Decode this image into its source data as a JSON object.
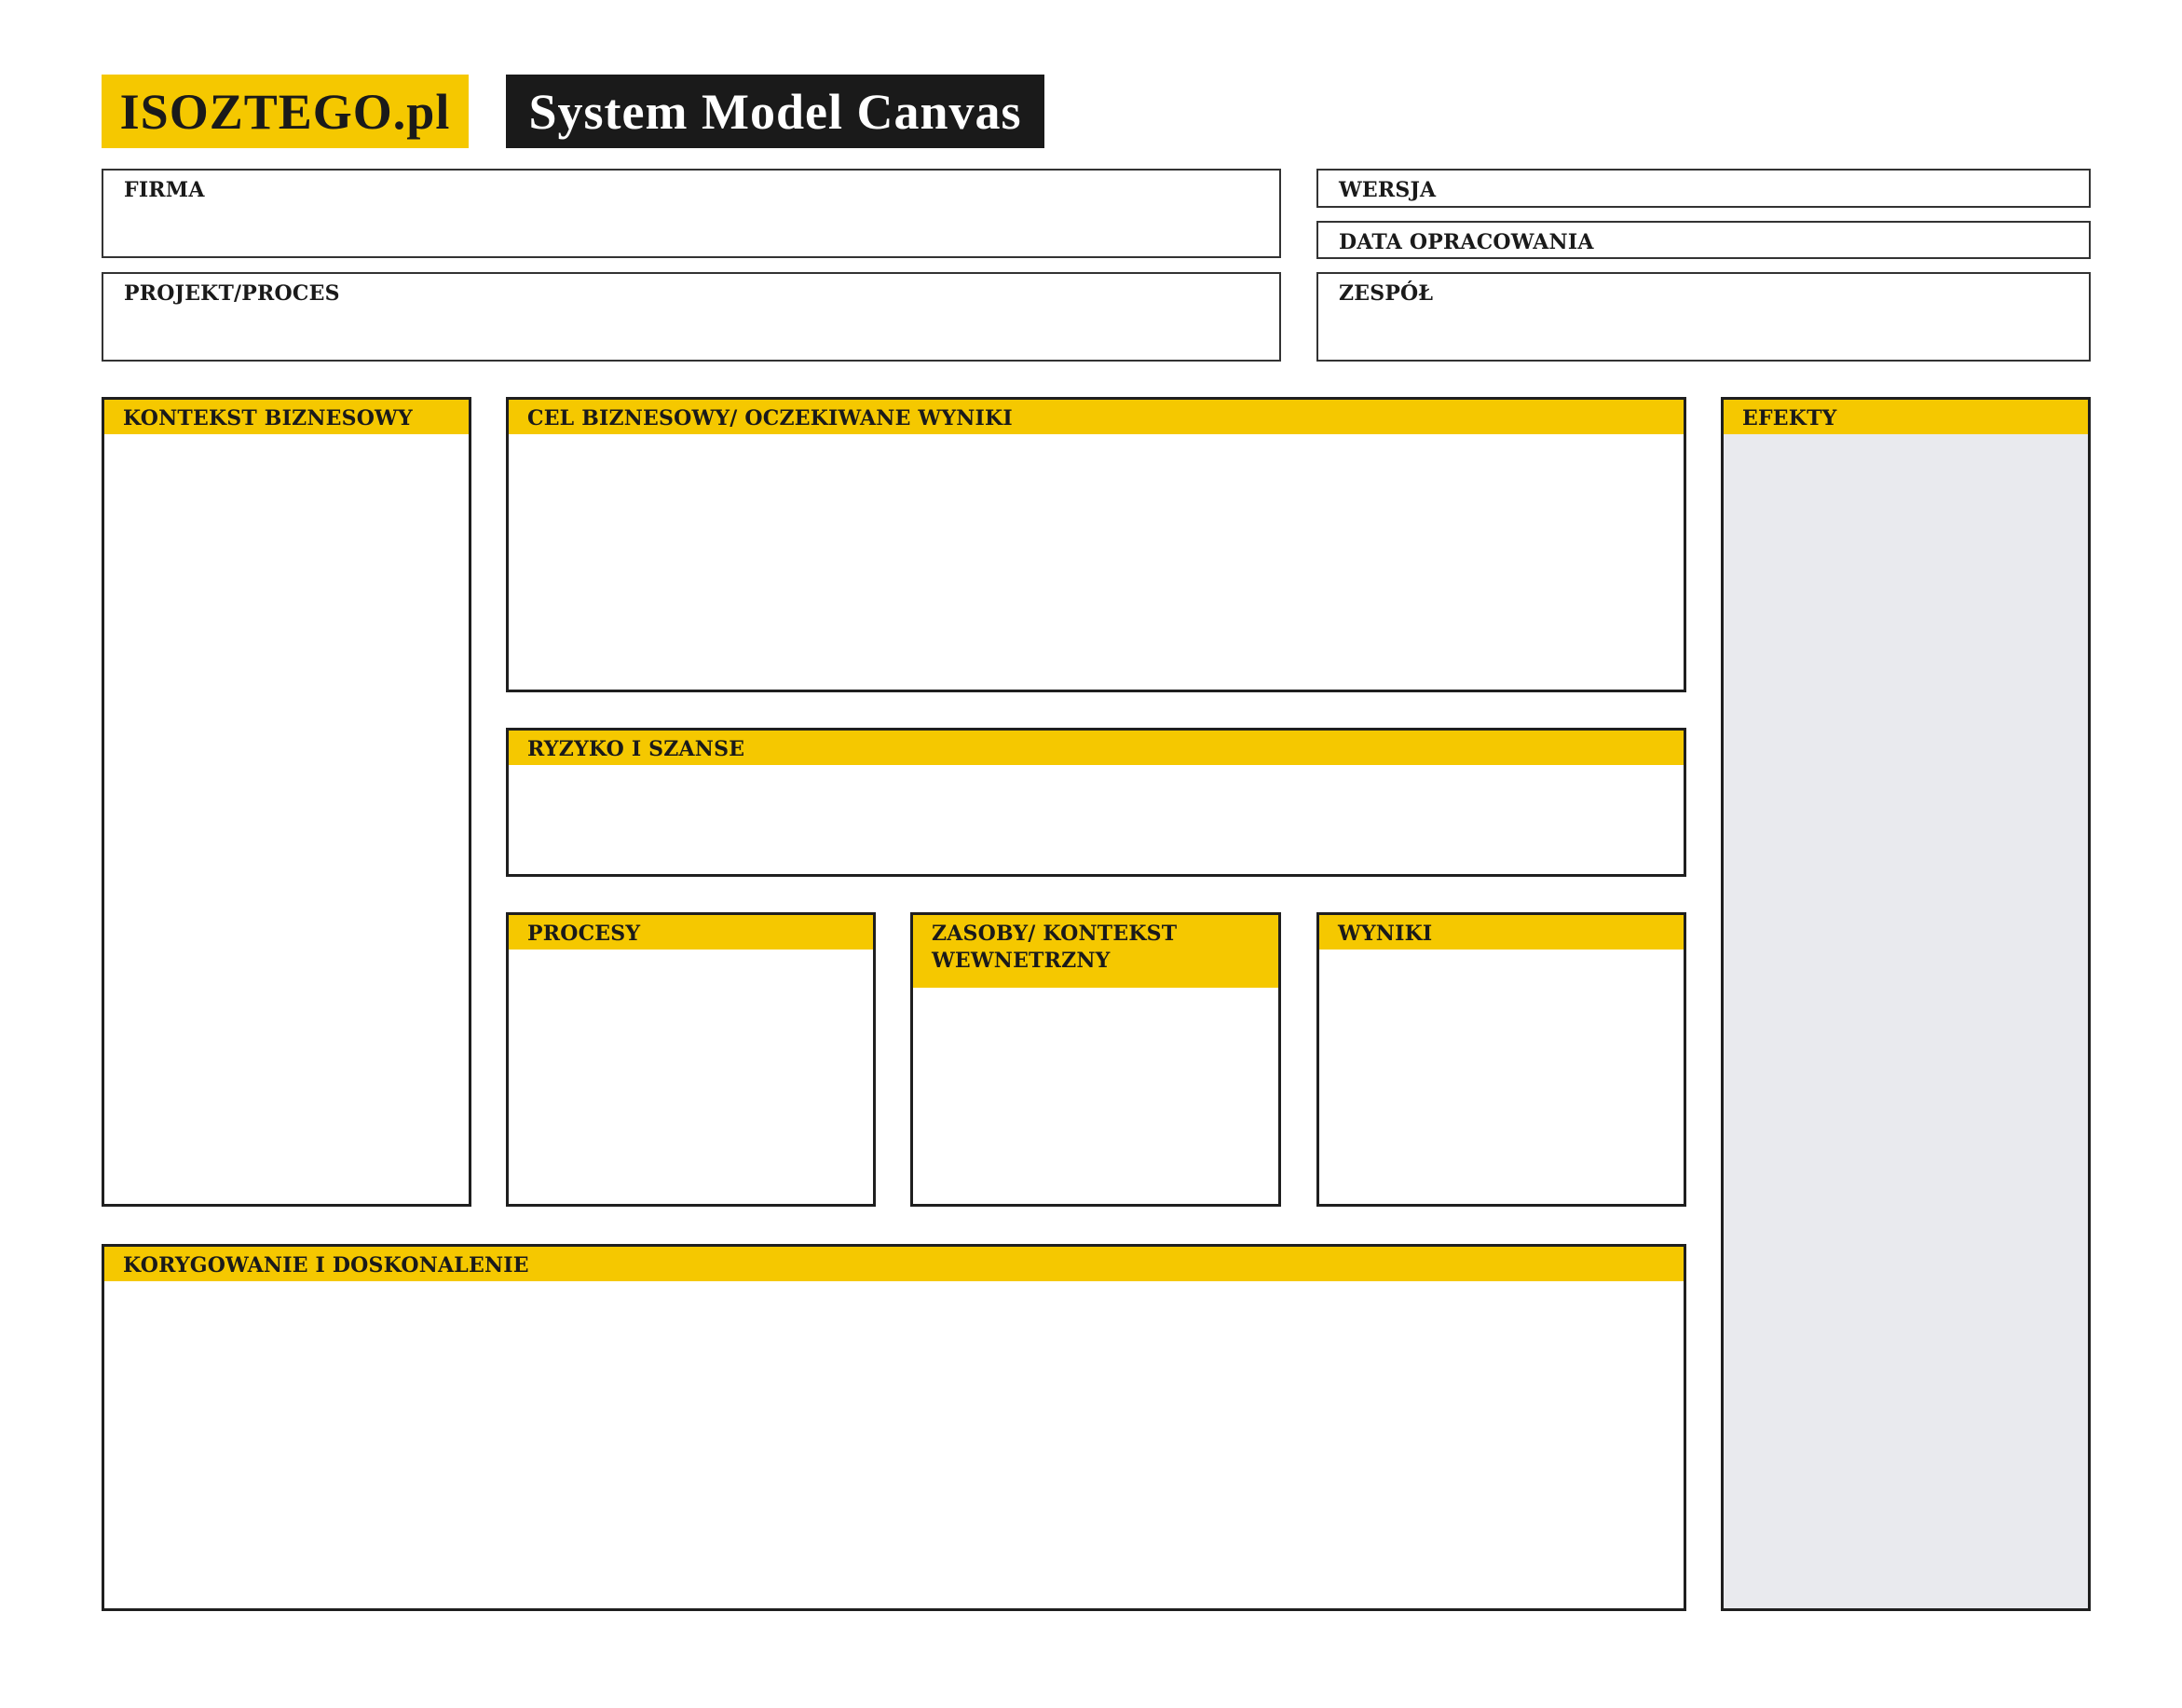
{
  "header": {
    "brand": "ISOZTEGO.pl",
    "title": "System Model Canvas"
  },
  "fields": {
    "firma": "FIRMA",
    "wersja": "WERSJA",
    "data": "DATA OPRACOWANIA",
    "projekt": "PROJEKT/PROCES",
    "zespol": "ZESPÓŁ"
  },
  "sections": {
    "kontekst": "KONTEKST BIZNESOWY",
    "cel": "CEL BIZNESOWY/ OCZEKIWANE WYNIKI",
    "efekty": "EFEKTY",
    "ryzyko": "RYZYKO I SZANSE",
    "procesy": "PROCESY",
    "zasoby": "ZASOBY/ KONTEKST\nWEWNETRZNY",
    "wyniki": "WYNIKI",
    "korygowanie": "KORYGOWANIE I DOSKONALENIE"
  },
  "colors": {
    "accent": "#f5c800",
    "dark": "#1a1a1a",
    "efekty_fill": "#e9eaee"
  }
}
